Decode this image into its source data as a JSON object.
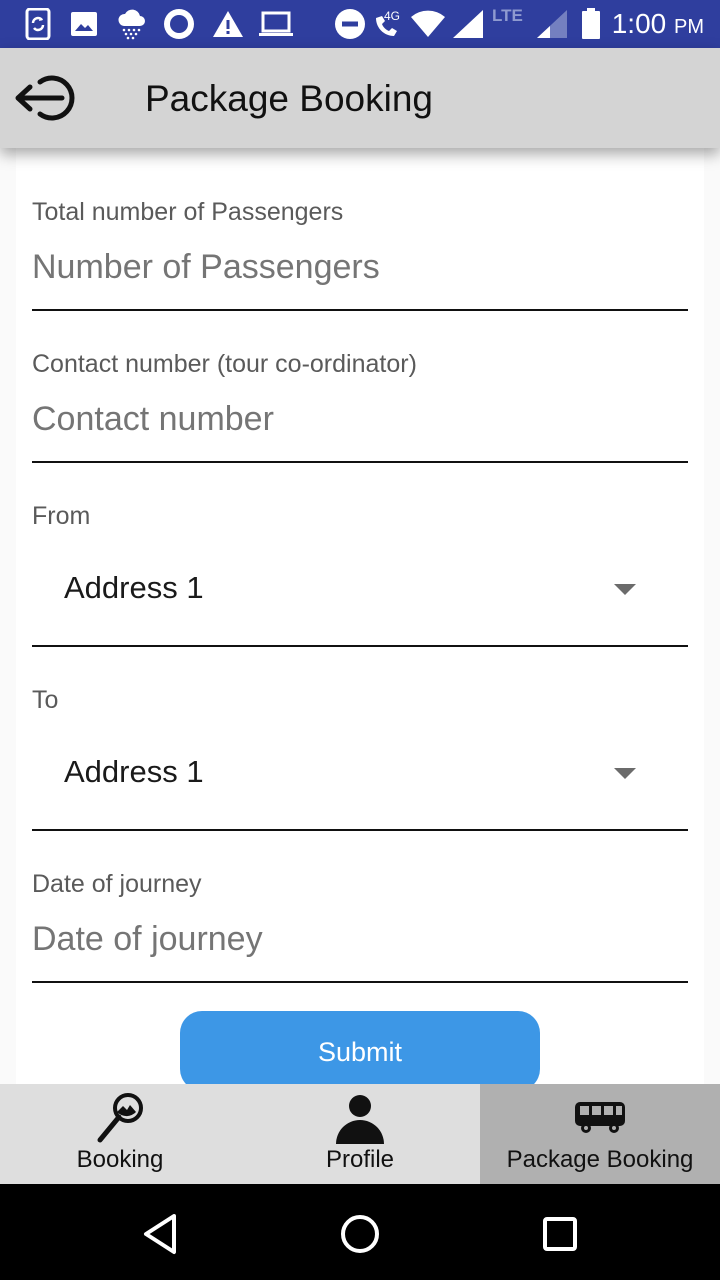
{
  "status_bar": {
    "icons": [
      "screen-rotate-icon",
      "image-icon",
      "rain-cloud-icon",
      "circle-ring-icon",
      "warning-icon",
      "laptop-icon",
      "do-not-disturb-icon",
      "wifi-call-icon",
      "wifi-icon",
      "signal-icon",
      "signal-weak-icon",
      "battery-icon"
    ],
    "call_badge": "4G",
    "network_type": "LTE",
    "time": "1:00",
    "time_suffix": "PM",
    "background_color": "#2f3e9e"
  },
  "app_bar": {
    "title": "Package Booking",
    "back_icon": "logout-arrow-icon"
  },
  "form": {
    "passengers": {
      "label": "Total number of Passengers",
      "placeholder": "Number of Passengers",
      "value": ""
    },
    "contact": {
      "label": "Contact number (tour co-ordinator)",
      "placeholder": "Contact number",
      "value": ""
    },
    "from": {
      "label": "From",
      "selected": "Address 1"
    },
    "to": {
      "label": "To",
      "selected": "Address 1"
    },
    "date": {
      "label": "Date of journey",
      "placeholder": "Date of journey",
      "value": ""
    },
    "submit_label": "Submit",
    "submit_color": "#3d97e6"
  },
  "bottom_nav": {
    "items": [
      {
        "label": "Booking",
        "icon": "search-map-icon",
        "active": false
      },
      {
        "label": "Profile",
        "icon": "person-icon",
        "active": false
      },
      {
        "label": "Package Booking",
        "icon": "bus-icon",
        "active": true
      }
    ]
  },
  "system_nav": {
    "buttons": [
      "back-icon",
      "home-icon",
      "recents-icon"
    ]
  }
}
